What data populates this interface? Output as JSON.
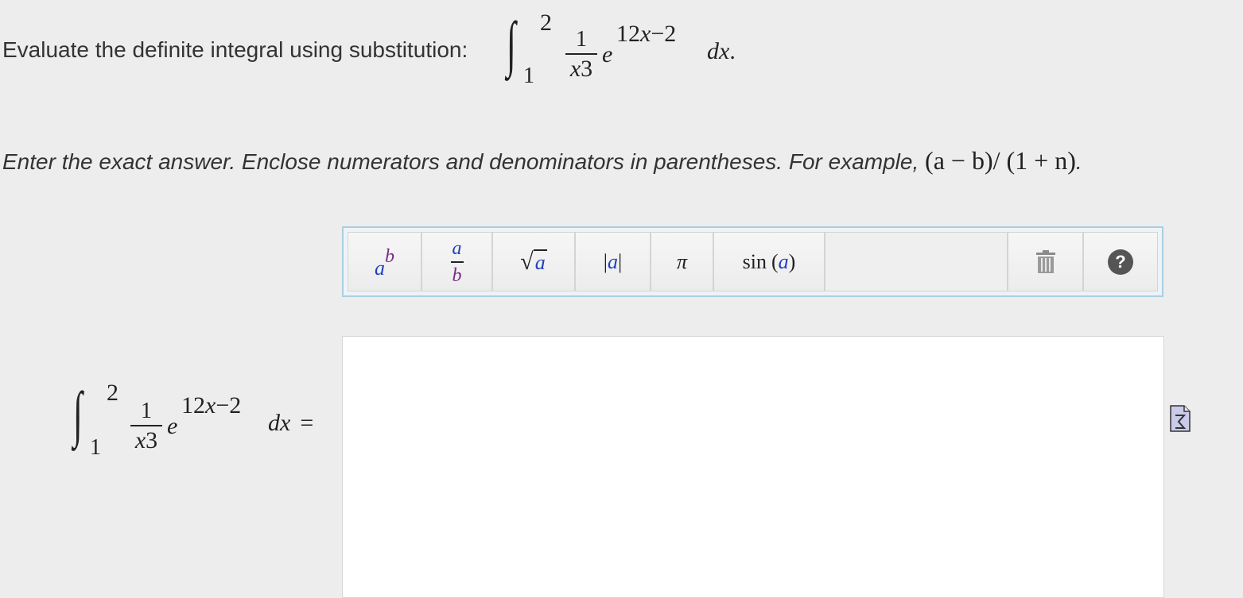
{
  "question": {
    "prompt": "Evaluate the definite integral using substitution:",
    "integral": {
      "upper": "2",
      "lower": "1",
      "numerator": "1",
      "denominator": "x",
      "denominator_power": "3",
      "exp_base": "e",
      "exp_power_coef": "12",
      "exp_power_var": "x",
      "exp_power_exp": "−2",
      "differential": "dx",
      "end_punct": "."
    }
  },
  "instruction": {
    "text": "Enter the exact answer. Enclose numerators and denominators in parentheses. For example,",
    "example": "(a − b)/ (1 + n)",
    "end": "."
  },
  "toolbar": {
    "power_base": "a",
    "power_exp": "b",
    "frac_num": "a",
    "frac_den": "b",
    "sqrt_symbol": "√",
    "sqrt_arg": "a",
    "abs_bar": "|",
    "abs_arg": "a",
    "pi": "π",
    "sin_fn": "sin",
    "sin_arg": "a",
    "open_paren": "(",
    "close_paren": ")",
    "trash_icon": "trash-icon",
    "help_icon": "help-icon",
    "help_glyph": "?"
  },
  "answer": {
    "equals": "=",
    "value": ""
  },
  "colors": {
    "background": "#ededed",
    "toolbar_border": "#a9cfe3",
    "variable_blue": "#1f3fbf",
    "variable_purple": "#7a2d86"
  }
}
